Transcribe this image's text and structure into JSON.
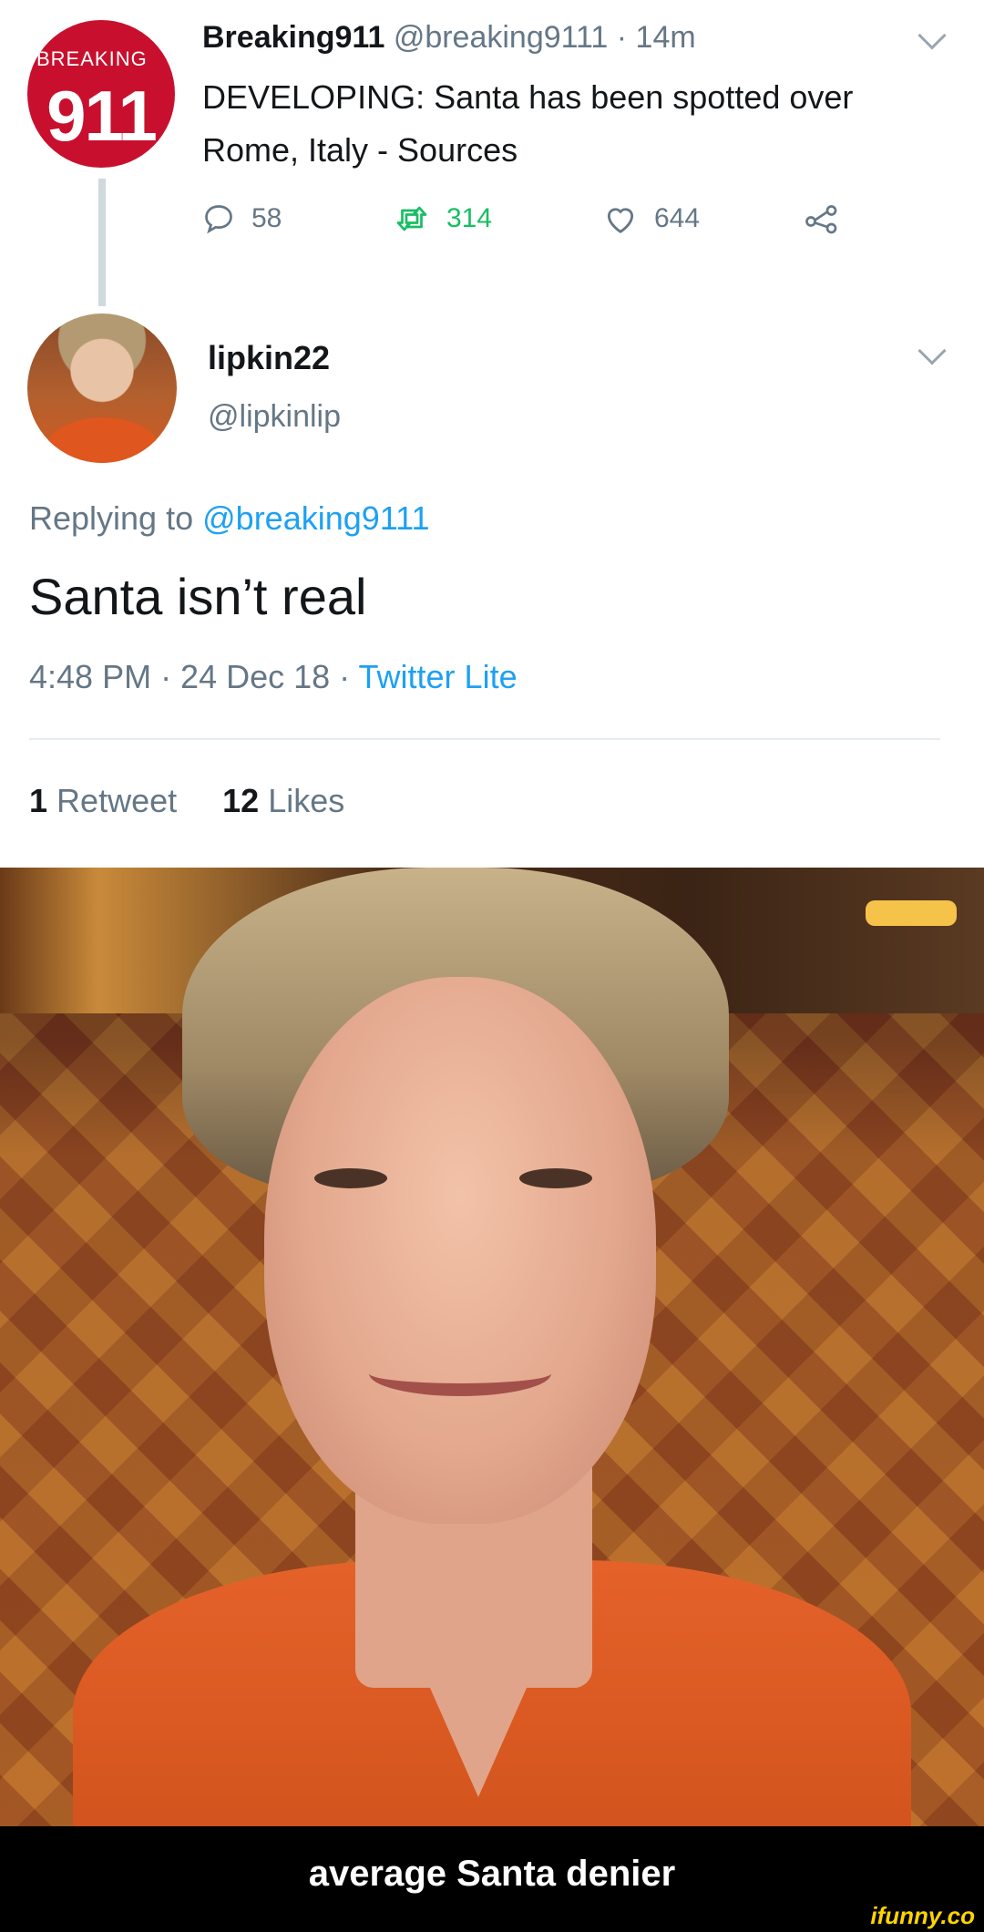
{
  "top_tweet": {
    "avatar_text_top": "BREAKING",
    "avatar_text_main": "911",
    "display_name": "Breaking911",
    "handle_and_time": "@breaking9111 · 14m",
    "text": "DEVELOPING: Santa has been spotted over Rome, Italy - Sources",
    "replies": "58",
    "retweets": "314",
    "likes": "644"
  },
  "reply_tweet": {
    "display_name": "lipkin22",
    "handle": "@lipkinlip",
    "replying_prefix": "Replying to",
    "replying_handle": "@breaking9111",
    "text": "Santa isn’t real",
    "timestamp": "4:48 PM · 24 Dec 18 ·",
    "client": "Twitter Lite",
    "retweet_count": "1",
    "retweet_label": "Retweet",
    "like_count": "12",
    "like_label": "Likes"
  },
  "caption": {
    "text": "average Santa denier",
    "watermark": "ifunny.co"
  },
  "colors": {
    "link_blue": "#1da1f2",
    "retweet_green": "#17bf63",
    "muted_gray": "#657786",
    "brand_red": "#c8102e"
  },
  "icons": [
    "reply-icon",
    "retweet-icon",
    "like-icon",
    "share-icon",
    "caret-down-icon"
  ]
}
